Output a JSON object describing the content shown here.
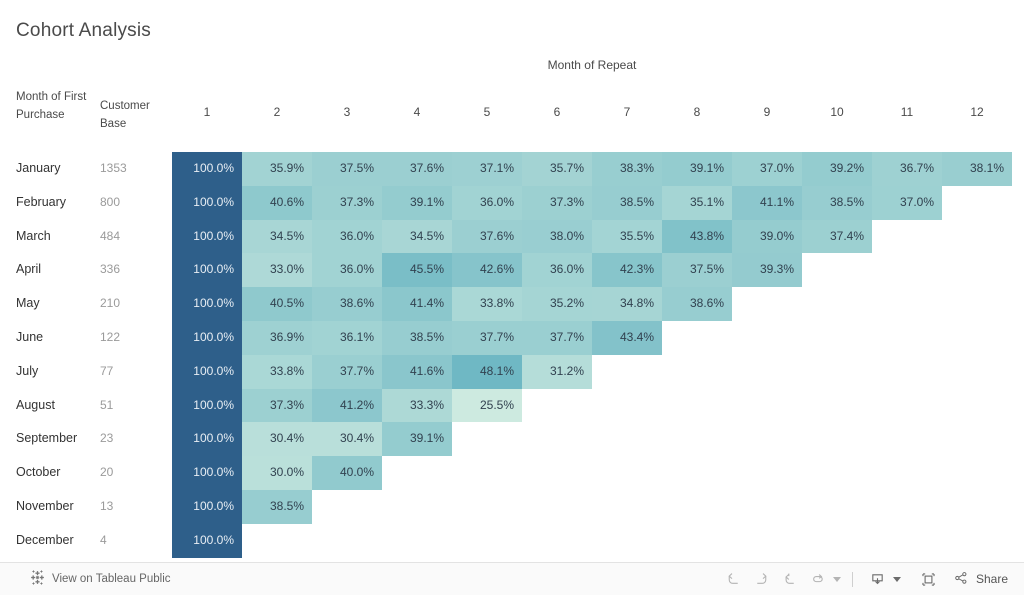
{
  "viz": {
    "title": "Cohort Analysis",
    "column_group_title": "Month of Repeat",
    "row_dimension_header": "Month of First Purchase",
    "measure_dimension_header": "Customer Base"
  },
  "colors": {
    "base_column": "#2e5f8a",
    "scale_low": "#cdeae0",
    "scale_high": "#6fb8c4",
    "text_dark": "#31414f",
    "text_light": "#e8eef4",
    "toolbar_bg": "#fafafa"
  },
  "toolbar": {
    "tableau_link_label": "View on Tableau Public",
    "share_label": "Share",
    "icons": {
      "tableau": "tableau-logo-icon",
      "undo": "undo-icon",
      "redo": "redo-icon",
      "revert": "revert-icon",
      "refresh": "refresh-icon",
      "refresh_caret": "chevron-down-icon",
      "download": "download-icon",
      "download_caret": "chevron-down-icon",
      "fullscreen": "fullscreen-icon",
      "share": "share-icon"
    }
  },
  "chart_data": {
    "type": "heatmap",
    "title": "Cohort Analysis",
    "xlabel": "Month of Repeat",
    "ylabel": "Month of First Purchase",
    "value_format": "percent-1dp",
    "legend": "none",
    "grid": false,
    "color_scale": {
      "low_color": "#cdeae0",
      "high_color": "#6fb8c4",
      "low_value": 25.5,
      "high_value": 48.1,
      "base_column_color": "#2e5f8a",
      "base_column_value": 100.0
    },
    "columns": [
      "1",
      "2",
      "3",
      "4",
      "5",
      "6",
      "7",
      "8",
      "9",
      "10",
      "11",
      "12"
    ],
    "secondary_column_header": "Customer Base",
    "rows": [
      {
        "label": "January",
        "customer_base": "1353",
        "values": [
          100.0,
          35.9,
          37.5,
          37.6,
          37.1,
          35.7,
          38.3,
          39.1,
          37.0,
          39.2,
          36.7,
          38.1
        ]
      },
      {
        "label": "February",
        "customer_base": "800",
        "values": [
          100.0,
          40.6,
          37.3,
          39.1,
          36.0,
          37.3,
          38.5,
          35.1,
          41.1,
          38.5,
          37.0,
          null
        ]
      },
      {
        "label": "March",
        "customer_base": "484",
        "values": [
          100.0,
          34.5,
          36.0,
          34.5,
          37.6,
          38.0,
          35.5,
          43.8,
          39.0,
          37.4,
          null,
          null
        ]
      },
      {
        "label": "April",
        "customer_base": "336",
        "values": [
          100.0,
          33.0,
          36.0,
          45.5,
          42.6,
          36.0,
          42.3,
          37.5,
          39.3,
          null,
          null,
          null
        ]
      },
      {
        "label": "May",
        "customer_base": "210",
        "values": [
          100.0,
          40.5,
          38.6,
          41.4,
          33.8,
          35.2,
          34.8,
          38.6,
          null,
          null,
          null,
          null
        ]
      },
      {
        "label": "June",
        "customer_base": "122",
        "values": [
          100.0,
          36.9,
          36.1,
          38.5,
          37.7,
          37.7,
          43.4,
          null,
          null,
          null,
          null,
          null
        ]
      },
      {
        "label": "July",
        "customer_base": "77",
        "values": [
          100.0,
          33.8,
          37.7,
          41.6,
          48.1,
          31.2,
          null,
          null,
          null,
          null,
          null,
          null
        ]
      },
      {
        "label": "August",
        "customer_base": "51",
        "values": [
          100.0,
          37.3,
          41.2,
          33.3,
          25.5,
          null,
          null,
          null,
          null,
          null,
          null,
          null
        ]
      },
      {
        "label": "September",
        "customer_base": "23",
        "values": [
          100.0,
          30.4,
          30.4,
          39.1,
          null,
          null,
          null,
          null,
          null,
          null,
          null,
          null
        ]
      },
      {
        "label": "October",
        "customer_base": "20",
        "values": [
          100.0,
          30.0,
          40.0,
          null,
          null,
          null,
          null,
          null,
          null,
          null,
          null,
          null
        ]
      },
      {
        "label": "November",
        "customer_base": "13",
        "values": [
          100.0,
          38.5,
          null,
          null,
          null,
          null,
          null,
          null,
          null,
          null,
          null,
          null
        ]
      },
      {
        "label": "December",
        "customer_base": "4",
        "values": [
          100.0,
          null,
          null,
          null,
          null,
          null,
          null,
          null,
          null,
          null,
          null,
          null
        ]
      }
    ]
  }
}
